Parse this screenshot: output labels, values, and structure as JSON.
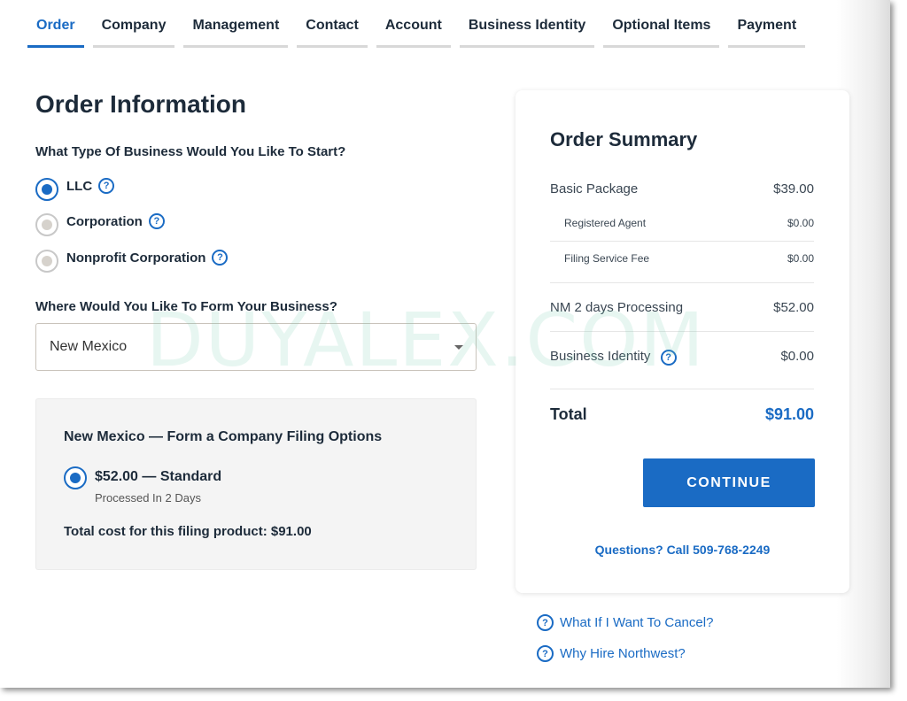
{
  "tabs": [
    "Order",
    "Company",
    "Management",
    "Contact",
    "Account",
    "Business Identity",
    "Optional Items",
    "Payment"
  ],
  "active_tab": "Order",
  "page_title": "Order Information",
  "business_type": {
    "question": "What Type Of Business Would You Like To Start?",
    "options": [
      {
        "label": "LLC",
        "selected": true
      },
      {
        "label": "Corporation",
        "selected": false
      },
      {
        "label": "Nonprofit Corporation",
        "selected": false
      }
    ],
    "help_glyph": "?"
  },
  "state": {
    "question": "Where Would You Like To Form Your Business?",
    "value": "New Mexico"
  },
  "filing": {
    "title": "New Mexico — Form a Company Filing Options",
    "option_label": "$52.00 — Standard",
    "option_sub": "Processed In 2 Days",
    "total": "Total cost for this filing product: $91.00"
  },
  "summary": {
    "title": "Order Summary",
    "rows": [
      {
        "label": "Basic Package",
        "value": "$39.00"
      },
      {
        "label": "Registered Agent",
        "value": "$0.00"
      },
      {
        "label": "Filing Service Fee",
        "value": "$0.00"
      },
      {
        "label": "NM 2 days Processing",
        "value": "$52.00"
      },
      {
        "label": "Business Identity",
        "value": "$0.00"
      }
    ],
    "total_label": "Total",
    "total_value": "$91.00",
    "continue_label": "CONTINUE",
    "phone": "Questions? Call 509-768-2249"
  },
  "faq": [
    "What If I Want To Cancel?",
    "Why Hire Northwest?"
  ],
  "watermark": "DUYALEX.COM",
  "colors": {
    "accent": "#1a6bc4",
    "text": "#1d2b3a",
    "tab_inactive_border": "#d8d8d8"
  }
}
